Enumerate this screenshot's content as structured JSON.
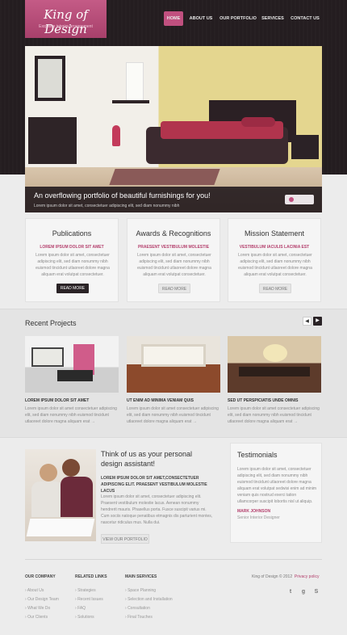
{
  "header": {
    "logo_title": "King of Design",
    "logo_tagline": "Exquisite interior arrangement",
    "nav": [
      "HOME",
      "ABOUT US",
      "OUR PORTFOLIO",
      "SERVICES",
      "CONTACT US"
    ],
    "active_nav": "HOME"
  },
  "hero": {
    "title": "An overflowing portfolio of beautiful furnishings for you!",
    "subtitle": "Lorem ipsum dolor sit amet, consectetuer adipiscing elit, sed diam nonummy nibh"
  },
  "features": [
    {
      "title": "Publications",
      "subtitle": "LOREM IPSUM DOLOR SIT AMET",
      "text": "Lorem ipsum dolor sit amet, consectetuer adipiscing elit, sed diam nonummy nibh euismod tincidunt utlaoreet dolore magna aliquam erat volutpat consectetuer.",
      "button": "READ MORE"
    },
    {
      "title": "Awards & Recognitions",
      "subtitle": "PRAESENT VESTIBULUM MOLESTIE",
      "text": "Lorem ipsum dolor sit amet, consectetuer adipiscing elit, sed diam nonummy nibh euismod tincidunt utlaoreet dolore magna aliquam erat volutpat consectetuer.",
      "button": "READ MORE"
    },
    {
      "title": "Mission Statement",
      "subtitle": "VESTIBULUM IACULIS LACINIA EST",
      "text": "Lorem ipsum dolor sit amet, consectetuer adipiscing elit, sed diam nonummy nibh euismod tincidunt utlaoreet dolore magna aliquam erat volutpat consectetuer.",
      "button": "READ MORE"
    }
  ],
  "projects": {
    "title": "Recent Projects",
    "items": [
      {
        "title": "LOREM IPSUM DOLOR SIT AMET",
        "text": "Lorem ipsum dolor sit amet consectetuer adipiscing elit, sed diam nonummy nibh euismod tincidunt utlaoreet dolore magna aliquam erat →"
      },
      {
        "title": "UT ENIM AD MINIMA VENIAM QUIS",
        "text": "Lorem ipsum dolor sit amet consectetuer adipiscing elit, sed diam nonummy nibh euismod tincidunt utlaoreet dolore magna aliquam erat →"
      },
      {
        "title": "SED UT PERSPICIATIS UNDE OMNIS",
        "text": "Lorem ipsum dolor sit amet consectetuer adipiscing elit, sed diam nonummy nibh euismod tincidunt utlaoreet dolore magna aliquam erat →"
      }
    ]
  },
  "designer": {
    "title_line1": "Think of us as your personal",
    "title_line2": "design assistant!",
    "subtitle": "LOREM IPSUM DOLOR SIT AMET,CONSECTETUER ADIPISCING ELIT. PRAESENT VESTIBULUM MOLESTIE LACUS",
    "text": "Lorem ipsum dolor sit amet, consectetuer adipiscing elit. Praesent vestibulum molestie lacus. Aenean nonummy hendrerit mauris. Phasellus porta. Fusce suscipit varius mi. Cum sociis natoque penatibus etmagnis dis parturient montes, nascetur ridiculus mus. Nulla dui.",
    "button": "VIEW OUR PORTFOLIO"
  },
  "testimonials": {
    "title": "Testimonials",
    "text": "Lorem ipsum dolor sit amet, consectetuer adipiscing elit, sed diam nonummy nibh euismod tincidunt utlaoreet dolore magna aliquam erat volutpat sedwisi enim ad minim veniam quis nostrud exerci tation ullamcorper suscipit lobortis nisl ut aliquip.",
    "name": "MARK JOHNSON",
    "role": "Senior Interior Designer"
  },
  "footer": {
    "col1_title": "OUR COMPANY",
    "col1": [
      "About Us",
      "Our Design Team",
      "What We Do",
      "Our Clients"
    ],
    "col2_title": "RELATED LINKS",
    "col2": [
      "Strategies",
      "Recent Issues",
      "FAQ",
      "Solutions"
    ],
    "col3_title": "MAIN SERVICES",
    "col3": [
      "Space Planning",
      "Selection and Installation",
      "Consultation",
      "Final Touches"
    ],
    "copyright": "King of Design © 2012",
    "privacy": "Privacy policy",
    "social": [
      "twitter-icon",
      "google-plus-icon",
      "skype-icon"
    ]
  },
  "colors": {
    "accent": "#b84d79",
    "dark": "#241d20",
    "background": "#ececec"
  }
}
